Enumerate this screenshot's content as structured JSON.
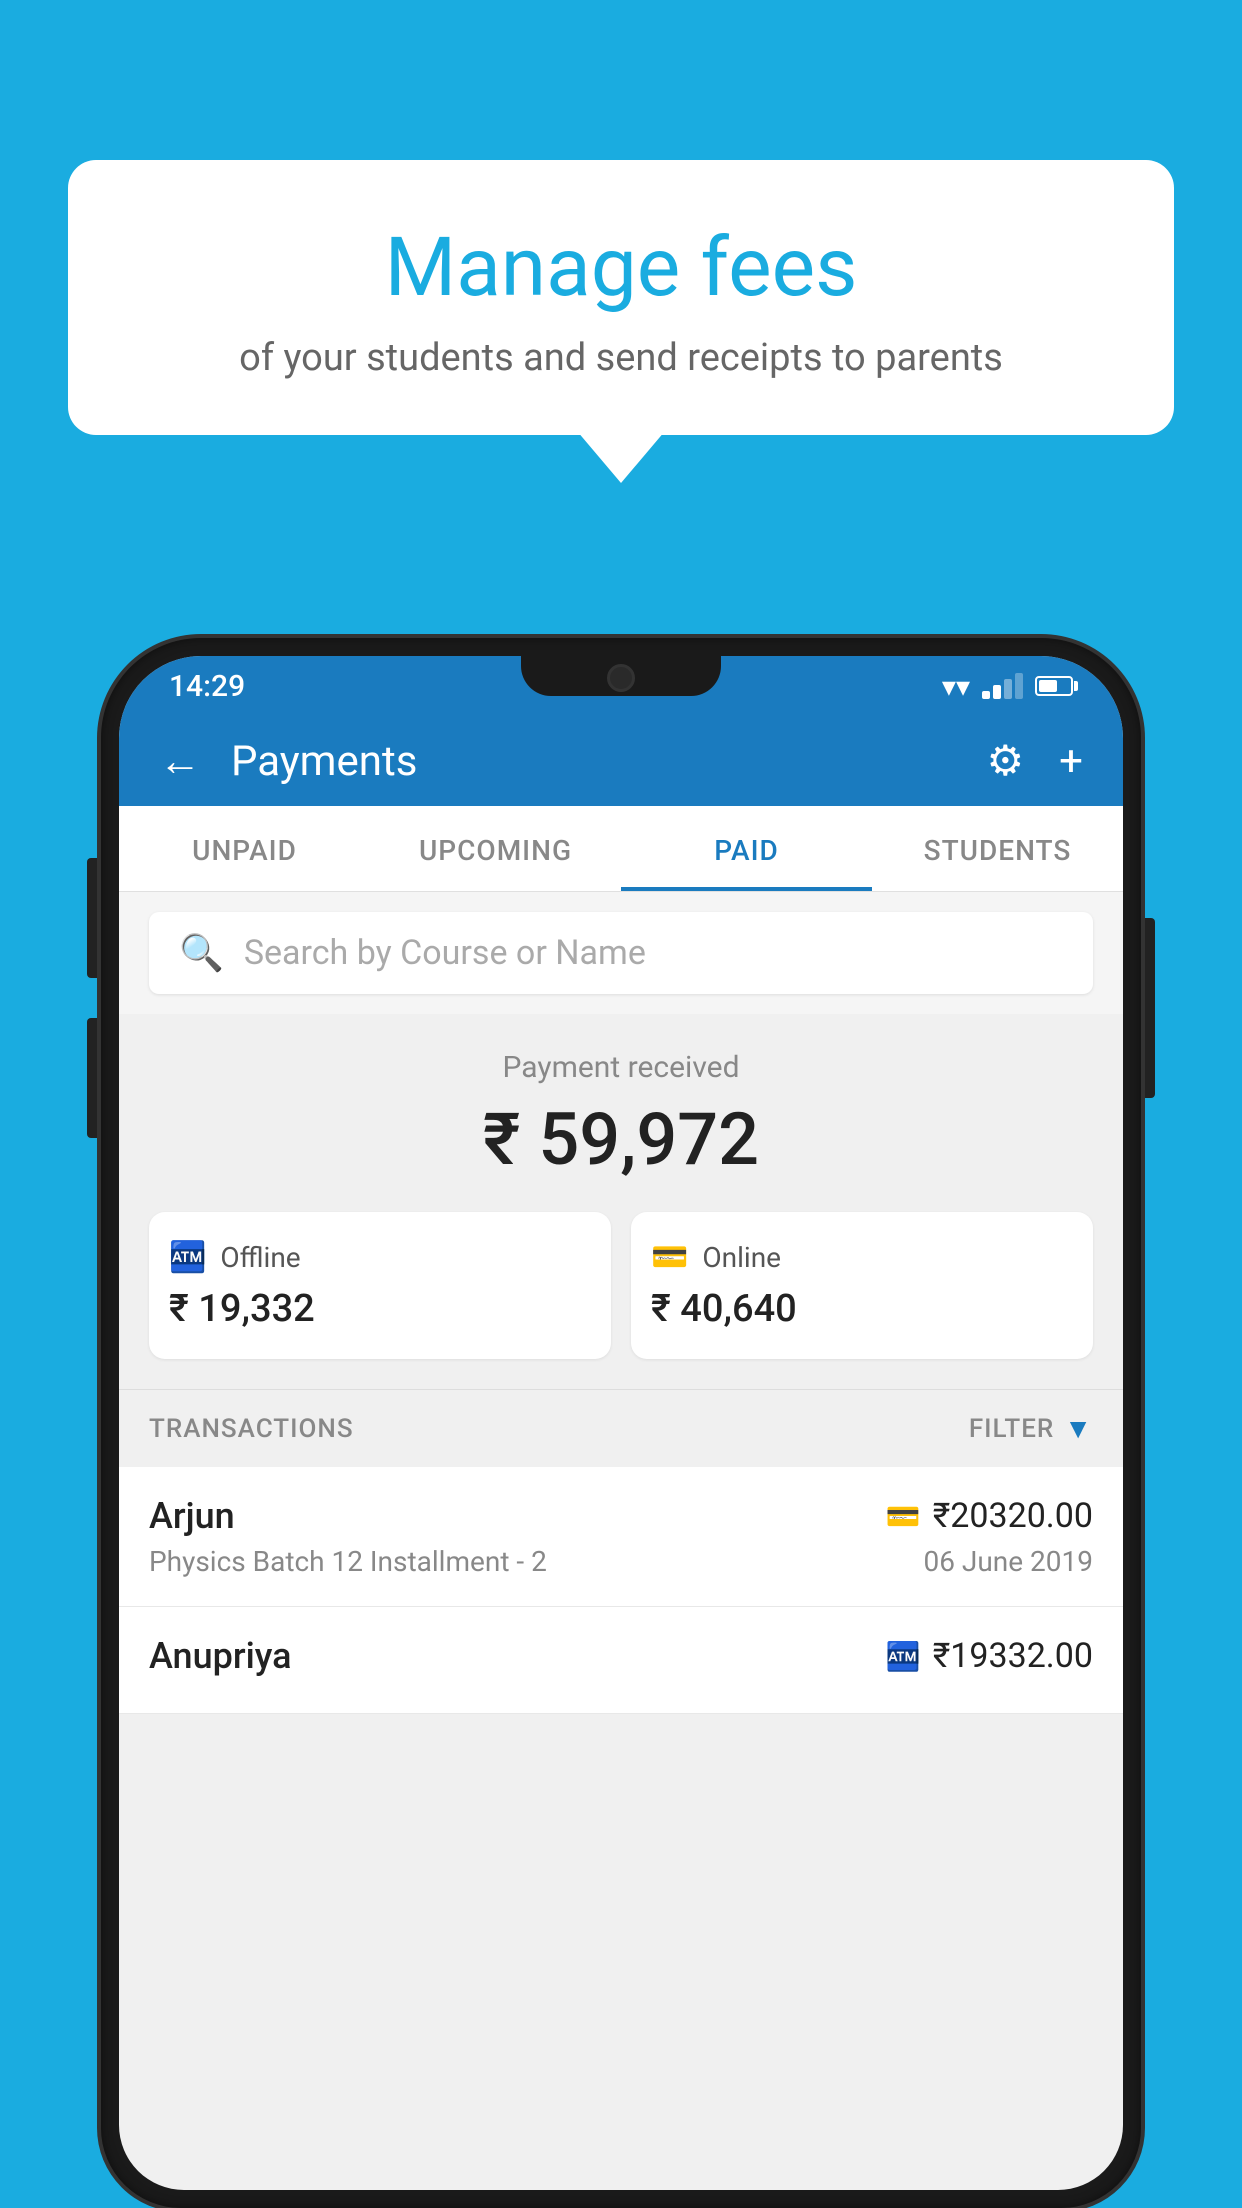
{
  "background": {
    "color": "#1AACE0"
  },
  "speech_bubble": {
    "title": "Manage fees",
    "subtitle": "of your students and send receipts to parents"
  },
  "status_bar": {
    "time": "14:29"
  },
  "header": {
    "title": "Payments",
    "back_label": "←",
    "gear_icon": "⚙",
    "plus_icon": "+"
  },
  "tabs": [
    {
      "label": "UNPAID",
      "active": false
    },
    {
      "label": "UPCOMING",
      "active": false
    },
    {
      "label": "PAID",
      "active": true
    },
    {
      "label": "STUDENTS",
      "active": false
    }
  ],
  "search": {
    "placeholder": "Search by Course or Name"
  },
  "payment_summary": {
    "label": "Payment received",
    "total": "₹ 59,972",
    "offline": {
      "type": "Offline",
      "amount": "₹ 19,332"
    },
    "online": {
      "type": "Online",
      "amount": "₹ 40,640"
    }
  },
  "transactions": {
    "header_label": "TRANSACTIONS",
    "filter_label": "FILTER",
    "rows": [
      {
        "name": "Arjun",
        "amount": "₹20320.00",
        "course": "Physics Batch 12 Installment - 2",
        "date": "06 June 2019",
        "payment_type": "card"
      },
      {
        "name": "Anupriya",
        "amount": "₹19332.00",
        "course": "",
        "date": "",
        "payment_type": "offline"
      }
    ]
  }
}
